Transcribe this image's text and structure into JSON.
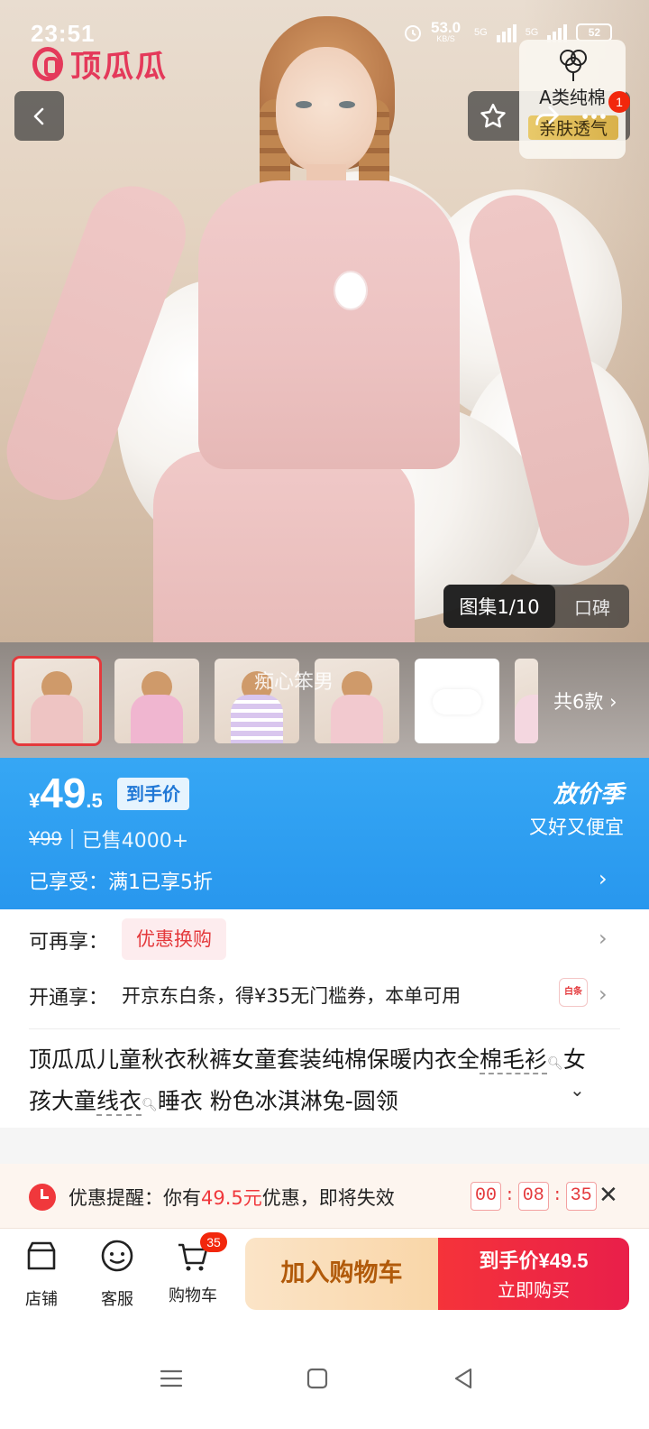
{
  "status_bar": {
    "time": "23:51",
    "net_speed": "53.0",
    "net_unit": "KB/S",
    "signal1": "5G",
    "signal2": "5G",
    "battery": "52"
  },
  "brand": {
    "name": "顶瓜瓜",
    "color": "#e4395a"
  },
  "badge": {
    "line1": "A类纯棉",
    "line2": "亲肤透气"
  },
  "cart_notice_count": "1",
  "gallery": {
    "active_label": "图集1/10",
    "other_label": "口碑"
  },
  "thumbnails": {
    "caption": "痴心笨男",
    "more_label": "共6款",
    "items": [
      {
        "name": "thumb-pink-set"
      },
      {
        "name": "thumb-bunny-print"
      },
      {
        "name": "thumb-striped"
      },
      {
        "name": "thumb-pink-kid"
      },
      {
        "name": "thumb-white-item"
      },
      {
        "name": "thumb-partial"
      }
    ]
  },
  "price": {
    "currency": "¥",
    "integer": "49",
    "decimal": ".5",
    "tag": "到手价",
    "original": "¥99",
    "sold": "已售4000+",
    "enjoyed": "已享受：满1已享5折",
    "season_title": "放价季",
    "season_sub": "又好又便宜",
    "accent": "#2897ee"
  },
  "promo": {
    "more_label": "可再享：",
    "coupon_chip": "优惠换购",
    "open_label": "开通享：",
    "baitiao_text": "开京东白条，得¥35无门槛券，本单可用",
    "baitiao_icon": "白条"
  },
  "title": {
    "part1": "顶瓜瓜儿童秋衣秋裤女童套装纯棉保暖内衣全",
    "underlined1": "棉毛衫",
    "part2": "女孩大童",
    "underlined2": "线衣",
    "part3": "睡衣 粉色冰淇淋兔-圆领"
  },
  "reminder": {
    "prefix": "优惠提醒：你有",
    "amount": "49.5元",
    "suffix": "优惠，即将失效",
    "hh": "00",
    "mm": "08",
    "ss": "35"
  },
  "bottom_bar": {
    "shop": "店铺",
    "service": "客服",
    "cart": "购物车",
    "cart_count": "35",
    "add_to_cart": "加入购物车",
    "buy_price_label": "到手价",
    "buy_price": "¥49.5",
    "buy_now": "立即购买"
  }
}
